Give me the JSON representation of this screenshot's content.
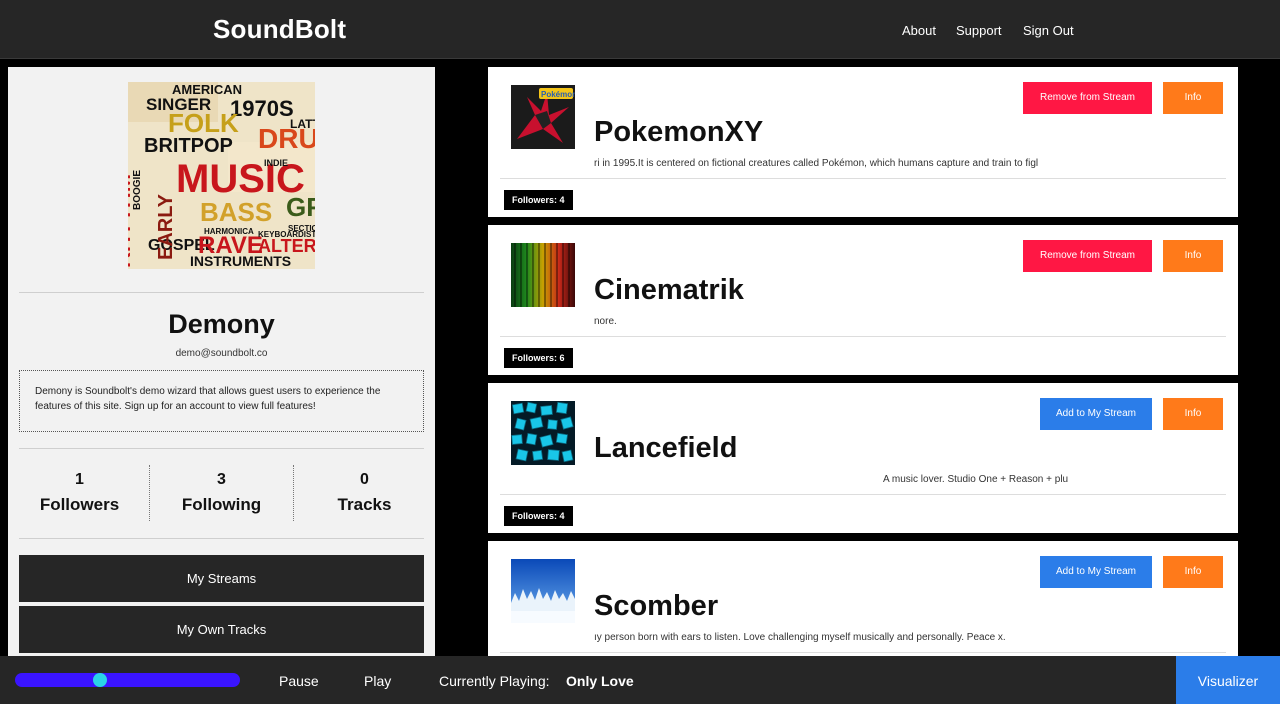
{
  "header": {
    "brand": "SoundBolt",
    "nav": [
      "About",
      "Support",
      "Sign Out"
    ]
  },
  "profile": {
    "name": "Demony",
    "email": "demo@soundbolt.co",
    "bio": "Demony is Soundbolt's demo wizard that allows guest users to experience the features of this site. Sign up for an account to view full features!",
    "stats": [
      {
        "value": "1",
        "label": "Followers"
      },
      {
        "value": "3",
        "label": "Following"
      },
      {
        "value": "0",
        "label": "Tracks"
      }
    ],
    "buttons": [
      "My Streams",
      "My Own Tracks"
    ],
    "avatar_words": [
      "AMERICAN",
      "SINGER",
      "1970S",
      "FOLK",
      "DRUM",
      "BRITPOP",
      "MUSIC",
      "BASS",
      "GOSPEL",
      "RAVE",
      "ALTERN",
      "INSTRUMENTS",
      "RHYTHM",
      "EARLY",
      "GRU",
      "INDIE",
      "KEYBOARDIST",
      "SECTION",
      "HARMONICA",
      "LATT",
      "BOOGIE"
    ]
  },
  "streams": [
    {
      "name": "PokemonXY",
      "description": "ri in 1995.It is centered on fictional creatures called Pokémon, which humans capture and train to figl",
      "followers": "Followers: 4",
      "action": "Remove from Stream",
      "action_type": "remove",
      "info": "Info",
      "thumb_text": "Pokémon Y"
    },
    {
      "name": "Cinematrik",
      "description": "nore.",
      "followers": "Followers: 6",
      "action": "Remove from Stream",
      "action_type": "remove",
      "info": "Info"
    },
    {
      "name": "Lancefield",
      "description": "A music lover. Studio One + Reason + plu",
      "followers": "Followers: 4",
      "action": "Add to My Stream",
      "action_type": "add",
      "info": "Info"
    },
    {
      "name": "Scomber",
      "description": "ıy person born with ears to listen. Love challenging myself musically and personally. Peace x.",
      "followers": "",
      "action": "Add to My Stream",
      "action_type": "add",
      "info": "Info"
    }
  ],
  "player": {
    "progress": 0.37,
    "pause": "Pause",
    "play": "Play",
    "now_playing_label": "Currently Playing:",
    "track": "Only Love",
    "visualizer": "Visualizer"
  },
  "colors": {
    "remove": "#ff1744",
    "add": "#2b7de9",
    "info": "#ff7a1a",
    "slider_track": "#3a14ff",
    "slider_thumb": "#2ad3e6"
  }
}
